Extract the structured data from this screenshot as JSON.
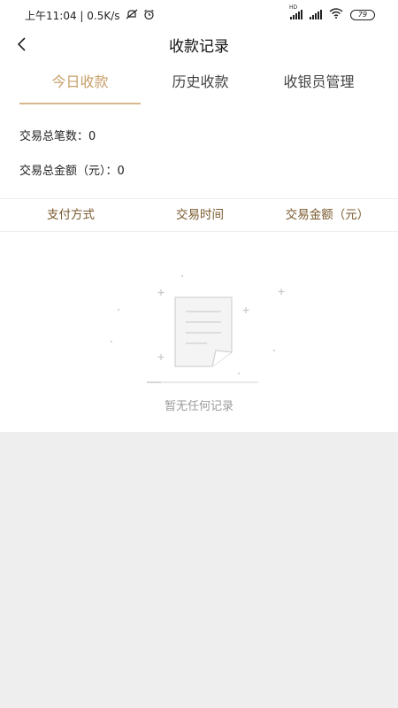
{
  "status": {
    "time_text": "上午11:04 | 0.5K/s",
    "network_hd": "HD",
    "battery": "79"
  },
  "nav": {
    "title": "收款记录"
  },
  "tabs": [
    {
      "label": "今日收款",
      "active": true
    },
    {
      "label": "历史收款",
      "active": false
    },
    {
      "label": "收银员管理",
      "active": false
    }
  ],
  "summary": {
    "count_label": "交易总笔数：",
    "count_value": "0",
    "amount_label": "交易总金额（元）：",
    "amount_value": "0"
  },
  "table": {
    "columns": [
      "支付方式",
      "交易时间",
      "交易金额（元）"
    ]
  },
  "empty": {
    "text": "暂无任何记录"
  },
  "colors": {
    "accent": "#c8a06a",
    "header_text": "#7a5a2e",
    "page_bg": "#eeeeee"
  }
}
